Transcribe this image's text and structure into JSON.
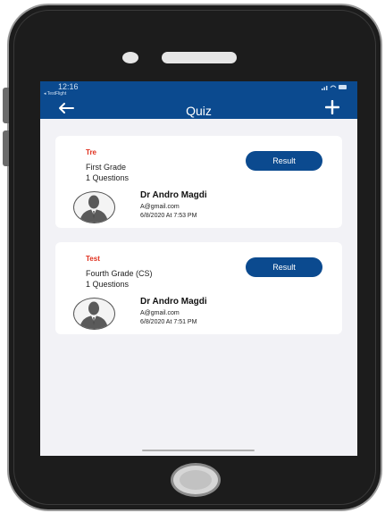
{
  "status_bar": {
    "time": "12:16",
    "carrier": "◂ TestFlight"
  },
  "header": {
    "title": "Quiz",
    "back_icon": "arrow-left-icon",
    "add_icon": "plus-icon"
  },
  "quizzes": [
    {
      "title": "Tre",
      "grade": "First Grade",
      "questions": "1 Questions",
      "result_label": "Result",
      "author_name": "Dr Andro Magdi",
      "author_email": "A@gmail.com",
      "date": "6/8/2020  At 7:53 PM"
    },
    {
      "title": "Test",
      "grade": "Fourth Grade (CS)",
      "questions": "1 Questions",
      "result_label": "Result",
      "author_name": "Dr Andro Magdi",
      "author_email": "A@gmail.com",
      "date": "6/8/2020  At 7:51 PM"
    }
  ],
  "colors": {
    "primary": "#0b4a8f",
    "title_red": "#e0301e",
    "background": "#f2f2f6"
  }
}
